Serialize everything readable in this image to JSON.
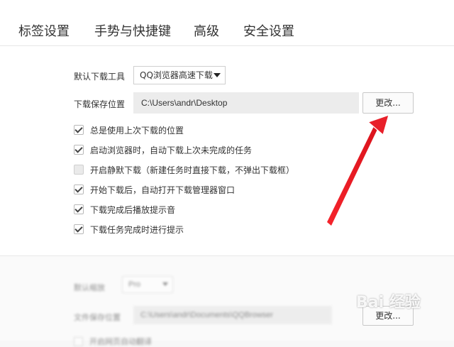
{
  "tabs": [
    {
      "label": "标签设置"
    },
    {
      "label": "手势与快捷键"
    },
    {
      "label": "高级"
    },
    {
      "label": "安全设置"
    }
  ],
  "download": {
    "tool_label": "默认下载工具",
    "tool_value": "QQ浏览器高速下载",
    "path_label": "下载保存位置",
    "path_value": "C:\\Users\\andr\\Desktop",
    "change_button": "更改..."
  },
  "options": [
    {
      "label": "总是使用上次下载的位置",
      "checked": true
    },
    {
      "label": "启动浏览器时，自动下载上次未完成的任务",
      "checked": true
    },
    {
      "label": "开启静默下载（新建任务时直接下载，不弹出下载框）",
      "checked": false
    },
    {
      "label": "开始下载后，自动打开下载管理器窗口",
      "checked": true
    },
    {
      "label": "下载完成后播放提示音",
      "checked": true
    },
    {
      "label": "下载任务完成时进行提示",
      "checked": true
    }
  ],
  "lower_section": {
    "row1_label": "默认缩放",
    "row1_value": "Pro",
    "row2_label": "文件保存位置",
    "row2_value": "C:\\Users\\andr\\Documents\\QQBrowser",
    "change_button": "更改...",
    "row3_label": "开启网页自动翻译"
  },
  "watermark": "Bai 经验",
  "colors": {
    "arrow": "#e8202a",
    "accent": "#333333"
  }
}
